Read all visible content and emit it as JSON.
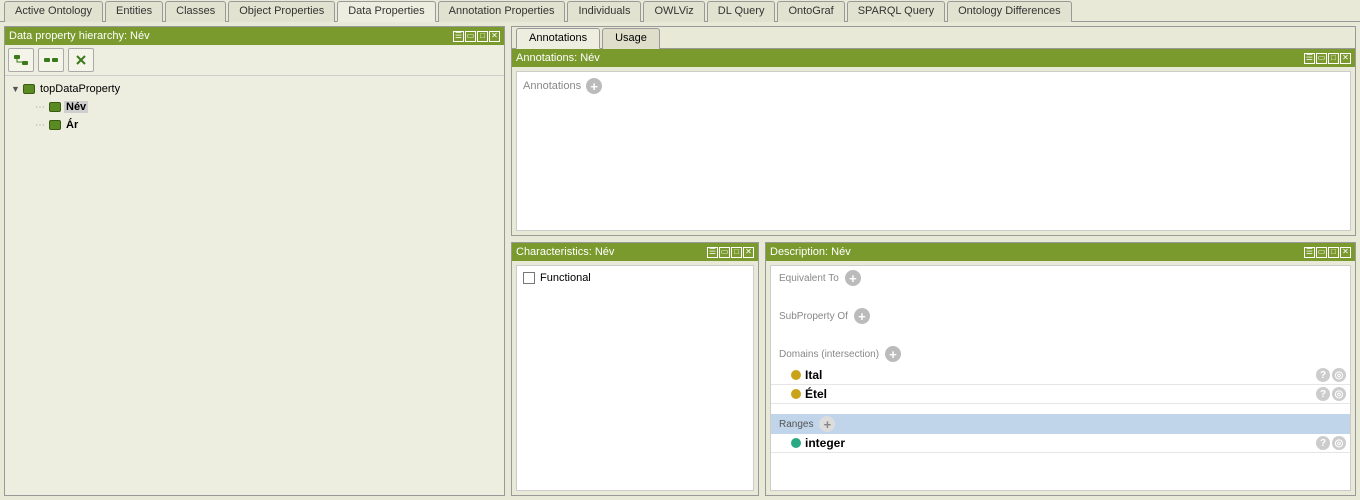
{
  "mainTabs": {
    "items": [
      {
        "label": "Active Ontology"
      },
      {
        "label": "Entities"
      },
      {
        "label": "Classes"
      },
      {
        "label": "Object Properties"
      },
      {
        "label": "Data Properties"
      },
      {
        "label": "Annotation Properties"
      },
      {
        "label": "Individuals"
      },
      {
        "label": "OWLViz"
      },
      {
        "label": "DL Query"
      },
      {
        "label": "OntoGraf"
      },
      {
        "label": "SPARQL Query"
      },
      {
        "label": "Ontology Differences"
      }
    ],
    "activeIndex": 4
  },
  "leftPanel": {
    "title": "Data property hierarchy: Név",
    "tree": {
      "root": "topDataProperty",
      "children": [
        {
          "label": "Név",
          "selected": true
        },
        {
          "label": "Ár",
          "selected": false
        }
      ]
    }
  },
  "subTabs": {
    "items": [
      {
        "label": "Annotations"
      },
      {
        "label": "Usage"
      }
    ],
    "activeIndex": 0
  },
  "annotationsPanel": {
    "title": "Annotations: Név",
    "addLabel": "Annotations"
  },
  "characteristicsPanel": {
    "title": "Characteristics: Név",
    "functionalLabel": "Functional"
  },
  "descriptionPanel": {
    "title": "Description: Név",
    "equivalentTo": "Equivalent To",
    "subPropertyOf": "SubProperty Of",
    "domainsLabel": "Domains (intersection)",
    "domains": [
      {
        "label": "Ital"
      },
      {
        "label": "Étel"
      }
    ],
    "rangesLabel": "Ranges",
    "ranges": [
      {
        "label": "integer"
      }
    ]
  }
}
